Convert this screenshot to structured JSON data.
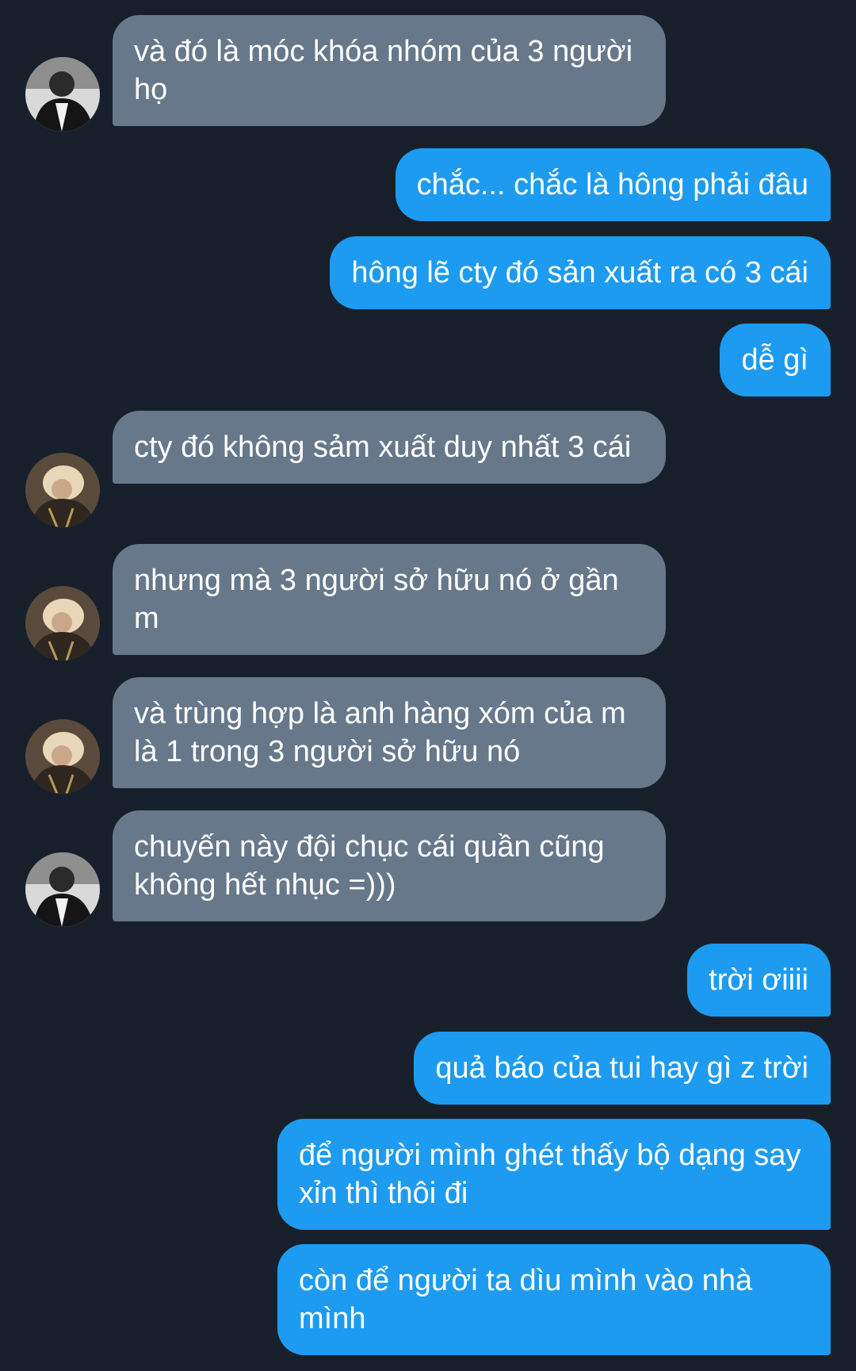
{
  "colors": {
    "background": "#17202a",
    "incoming_bubble": "#66788a",
    "outgoing_bubble": "#1d9bf0",
    "text": "#ffffff"
  },
  "messages": [
    {
      "side": "in",
      "avatar": "dark-hair-profile-avatar",
      "text": "và đó là móc khóa nhóm của 3 người họ"
    },
    {
      "side": "out",
      "text": "chắc... chắc là hông phải đâu"
    },
    {
      "side": "out",
      "text": "hông lẽ cty đó sản xuất ra có 3 cái"
    },
    {
      "side": "out",
      "text": "dễ gì"
    },
    {
      "side": "in",
      "avatar": "blonde-hair-profile-avatar",
      "text": "cty đó không sảm xuất duy nhất 3 cái"
    },
    {
      "side": "in",
      "avatar": "blonde-hair-profile-avatar",
      "text": "nhưng mà 3 người sở hữu nó ở gần m"
    },
    {
      "side": "in",
      "avatar": "blonde-hair-profile-avatar",
      "text": "và trùng hợp là anh hàng xóm của m là 1 trong 3 người sở hữu nó"
    },
    {
      "side": "in",
      "avatar": "dark-hair-profile-avatar",
      "text": "chuyến này đội chục cái quần cũng không hết nhục =)))"
    },
    {
      "side": "out",
      "text": "trời ơiiii"
    },
    {
      "side": "out",
      "text": "quả báo của tui hay gì z trời"
    },
    {
      "side": "out",
      "text": "để người mình ghét thấy bộ dạng say xỉn thì thôi đi"
    },
    {
      "side": "out",
      "text": "còn để người ta dìu mình vào nhà mình"
    }
  ]
}
